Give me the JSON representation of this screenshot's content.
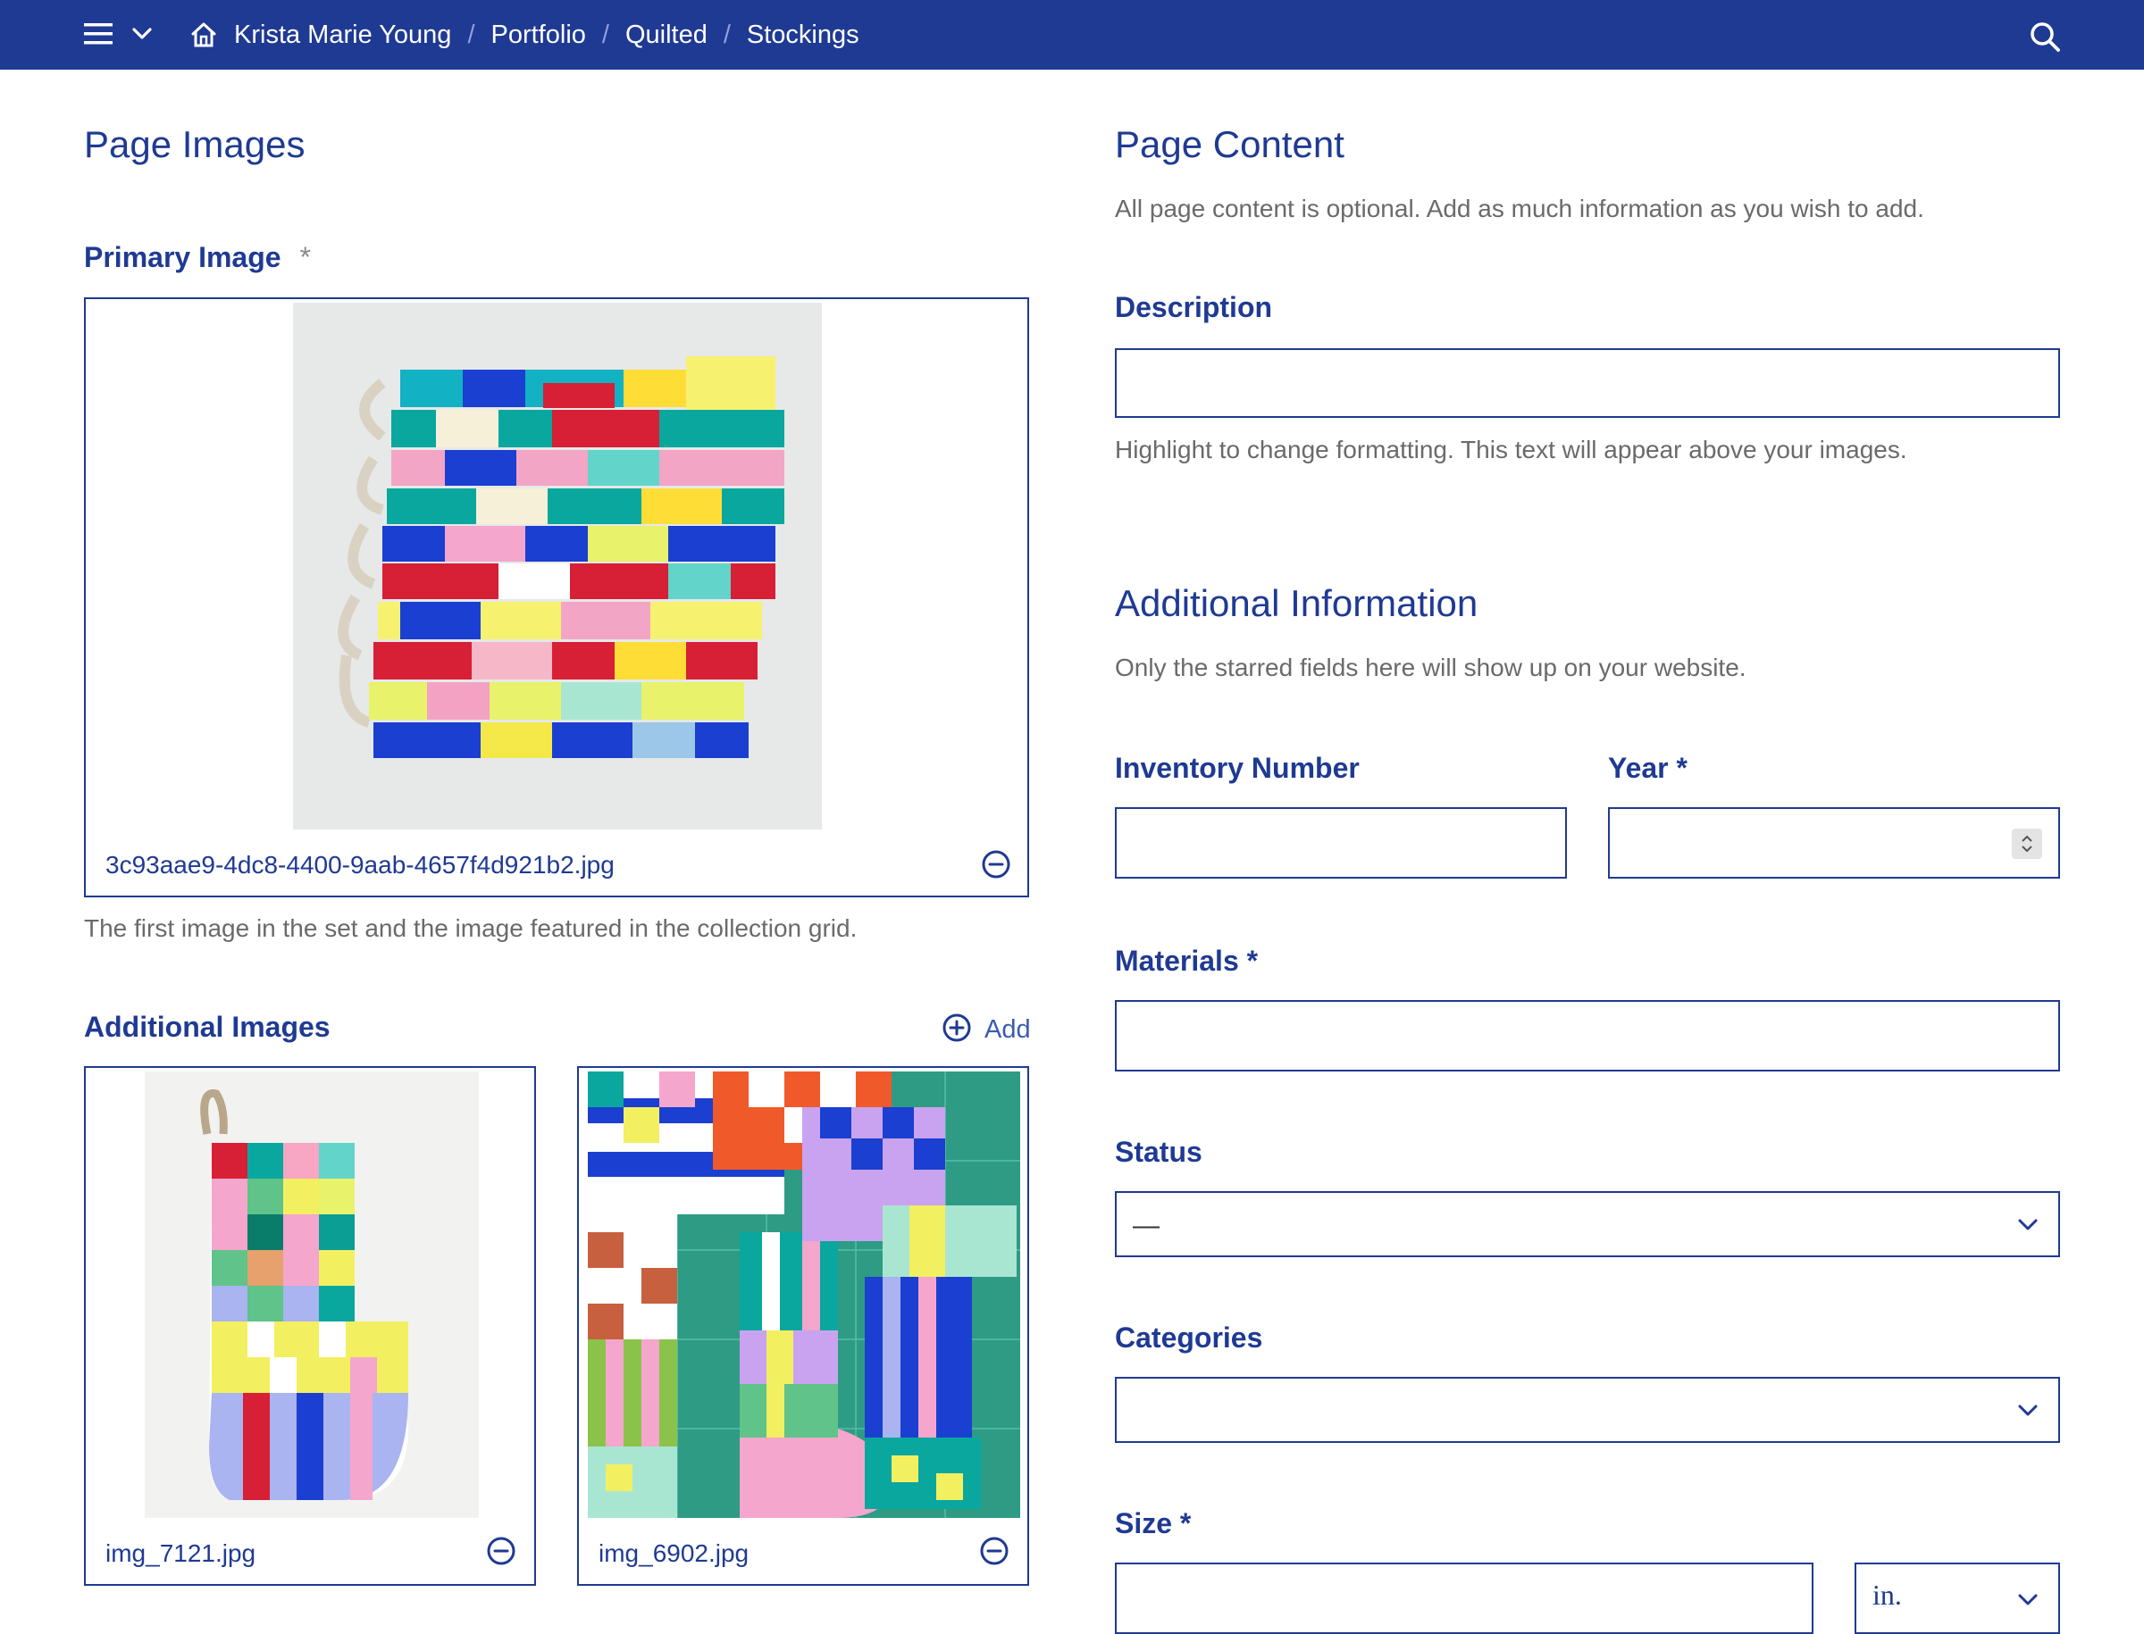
{
  "topbar": {
    "breadcrumbs": [
      "Krista Marie Young",
      "Portfolio",
      "Quilted",
      "Stockings"
    ],
    "separator": "/",
    "icons": [
      "hamburger-menu-icon",
      "chevron-down-icon",
      "home-icon",
      "search-icon"
    ]
  },
  "left": {
    "heading": "Page Images",
    "primary_label": "Primary Image",
    "primary_required": "*",
    "primary_filename": "3c93aae9-4dc8-4400-9aab-4657f4d921b2.jpg",
    "primary_help": "The first image in the set and the image featured in the collection grid.",
    "additional_label": "Additional Images",
    "add_label": "Add",
    "additional": [
      {
        "filename": "img_7121.jpg"
      },
      {
        "filename": "img_6902.jpg"
      }
    ]
  },
  "right": {
    "heading": "Page Content",
    "intro": "All page content is optional. Add as much information as you wish to add.",
    "description_label": "Description",
    "description_help": "Highlight to change formatting. This text will appear above your images.",
    "additional_heading": "Additional Information",
    "additional_intro": "Only the starred fields here will show up on your website.",
    "inventory_label": "Inventory Number",
    "year_label": "Year *",
    "materials_label": "Materials *",
    "status_label": "Status",
    "status_value": "—",
    "categories_label": "Categories",
    "size_label": "Size *",
    "size_unit": "in."
  },
  "colors": {
    "brand": "#1f3a93",
    "muted": "#6a6a6a"
  }
}
